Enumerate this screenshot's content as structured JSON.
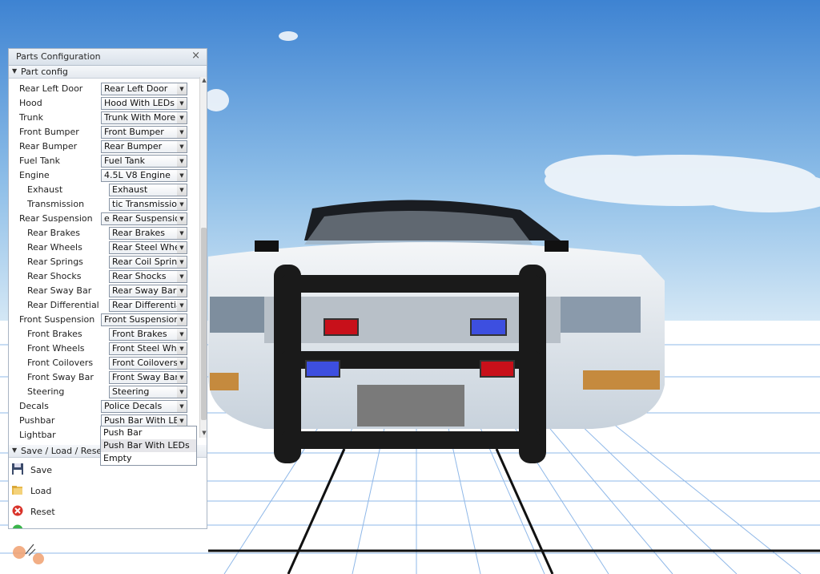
{
  "window": {
    "title": "Parts Configuration",
    "close_glyph": "×"
  },
  "part_config": {
    "section_label": "Part config",
    "rows": [
      {
        "label": "Rear Left Door",
        "value": "Rear Left Door"
      },
      {
        "label": "Hood",
        "value": "Hood With LEDs"
      },
      {
        "label": "Trunk",
        "value": "Trunk With More LEDs"
      },
      {
        "label": "Front Bumper",
        "value": "Front Bumper"
      },
      {
        "label": "Rear Bumper",
        "value": "Rear Bumper"
      },
      {
        "label": "Fuel Tank",
        "value": "Fuel Tank"
      },
      {
        "label": "Engine",
        "value": "4.5L V8 Engine"
      },
      {
        "label": "Exhaust",
        "value": "Exhaust"
      },
      {
        "label": "Transmission",
        "value": "tic Transmission"
      },
      {
        "label": "Rear Suspension",
        "value": "e Rear Suspension"
      },
      {
        "label": "Rear Brakes",
        "value": "Rear Brakes"
      },
      {
        "label": "Rear Wheels",
        "value": "Rear Steel Wheels"
      },
      {
        "label": "Rear Springs",
        "value": "Rear Coil Springs"
      },
      {
        "label": "Rear Shocks",
        "value": "Rear Shocks"
      },
      {
        "label": "Rear Sway Bar",
        "value": "Rear Sway Bar"
      },
      {
        "label": "Rear Differential",
        "value": "Rear Differential"
      },
      {
        "label": "Front Suspension",
        "value": "Front Suspension"
      },
      {
        "label": "Front Brakes",
        "value": "Front Brakes"
      },
      {
        "label": "Front Wheels",
        "value": "Front Steel Wheels"
      },
      {
        "label": "Front Coilovers",
        "value": "Front Coilovers"
      },
      {
        "label": "Front Sway Bar",
        "value": "Front Sway Bar"
      },
      {
        "label": "Steering",
        "value": "Steering"
      },
      {
        "label": "Decals",
        "value": "Police Decals"
      },
      {
        "label": "Pushbar",
        "value": "Push Bar With LEDs"
      },
      {
        "label": "Lightbar",
        "value": ""
      }
    ]
  },
  "pushbar_dropdown": {
    "options": [
      "Push Bar",
      "Push Bar With LEDs",
      "Empty"
    ],
    "highlighted": "Push Bar With LEDs"
  },
  "save_load_reset": {
    "section_label": "Save / Load / Reset",
    "actions": [
      {
        "label": "Save",
        "icon": "floppy-disk-icon"
      },
      {
        "label": "Load",
        "icon": "folder-open-icon"
      },
      {
        "label": "Reset",
        "icon": "red-x-circle-icon"
      }
    ]
  },
  "colors": {
    "sky_top": "#4f8fd6",
    "sky_bottom": "#d6e9f7",
    "floor": "#ffffff",
    "grid": "#8fb8e8",
    "light_red": "#c8101a",
    "light_blue": "#3d4fe0"
  }
}
